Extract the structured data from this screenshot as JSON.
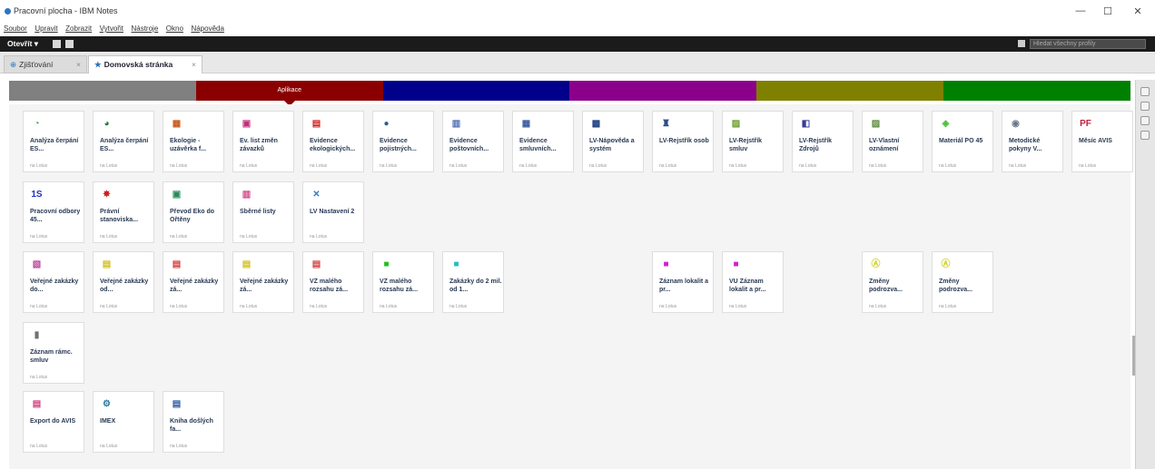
{
  "window": {
    "title": "Pracovní plocha - IBM Notes",
    "minimize": "—",
    "maximize": "☐",
    "close": "✕"
  },
  "menu": [
    "Soubor",
    "Upravit",
    "Zobrazit",
    "Vytvořit",
    "Nástroje",
    "Okno",
    "Nápověda"
  ],
  "toolbar": {
    "open_label": "Otevřít ▾",
    "search_placeholder": "Hledat všechny profily"
  },
  "tabs": [
    {
      "label": "Zjišťování",
      "icon": "⊕",
      "close": "×"
    },
    {
      "label": "Domovská stránka",
      "icon": "★",
      "close": "×"
    }
  ],
  "categories": [
    {
      "label": "",
      "color": "#808080"
    },
    {
      "label": "Aplikace",
      "color": "#8a0000"
    },
    {
      "label": "",
      "color": "#00008b"
    },
    {
      "label": "",
      "color": "#8b008b"
    },
    {
      "label": "",
      "color": "#808000"
    },
    {
      "label": "",
      "color": "#008000"
    }
  ],
  "server_label": "na Lotus",
  "tiles": [
    {
      "name": "Analýza čerpání ES...",
      "glyph": "◔",
      "color": "#2ea84a"
    },
    {
      "name": "Analýza čerpání ES...",
      "glyph": "◕",
      "color": "#1a7a3a"
    },
    {
      "name": "Ekologie - uzávěrka f...",
      "glyph": "▦",
      "color": "#c85a1a"
    },
    {
      "name": "Ev. list změn závazků",
      "glyph": "▣",
      "color": "#c0307a"
    },
    {
      "name": "Evidence ekologických...",
      "glyph": "▤",
      "color": "#d02020"
    },
    {
      "name": "Evidence pojistných...",
      "glyph": "●",
      "color": "#345e8a"
    },
    {
      "name": "Evidence poštovních...",
      "glyph": "▥",
      "color": "#4a6ab0"
    },
    {
      "name": "Evidence smluvních...",
      "glyph": "▦",
      "color": "#3a5aa0"
    },
    {
      "name": "LV-Nápověda a systém",
      "glyph": "▩",
      "color": "#204080"
    },
    {
      "name": "LV-Rejstřík osob",
      "glyph": "♜",
      "color": "#2a4a8a"
    },
    {
      "name": "LV-Rejstřík smluv",
      "glyph": "▨",
      "color": "#6a9a2a"
    },
    {
      "name": "LV-Rejstřík Zdrojů",
      "glyph": "◧",
      "color": "#3a3a9a"
    },
    {
      "name": "LV-Vlastní oznámení",
      "glyph": "▨",
      "color": "#5a8a3a"
    },
    {
      "name": "Materiál PO 45",
      "glyph": "◈",
      "color": "#4ac040"
    },
    {
      "name": "Metodické pokyny V...",
      "glyph": "◉",
      "color": "#6a7a8a"
    },
    {
      "name": "Měsíc AVIS",
      "glyph": "PF",
      "color": "#c02040"
    },
    {
      "name": "Pracovní odbory 45...",
      "glyph": "1S",
      "color": "#2030c0"
    },
    {
      "name": "Právní stanoviska...",
      "glyph": "✸",
      "color": "#d02020"
    },
    {
      "name": "Převod Eko do Ořtěny",
      "glyph": "▣",
      "color": "#2a8a5a"
    },
    {
      "name": "Sběrné listy",
      "glyph": "▥",
      "color": "#d04080"
    },
    {
      "name": "LV Nastavení 2",
      "glyph": "✕",
      "color": "#3a7ac0"
    },
    {
      "name": "Veřejné zakázky do...",
      "glyph": "▧",
      "color": "#c040a0"
    },
    {
      "name": "Veřejné zakázky od...",
      "glyph": "▤",
      "color": "#d0c020"
    },
    {
      "name": "Veřejné zakázky zá...",
      "glyph": "▤",
      "color": "#d04040"
    },
    {
      "name": "Veřejné zakázky zá...",
      "glyph": "▤",
      "color": "#d0c020"
    },
    {
      "name": "VZ malého rozsahu zá...",
      "glyph": "▤",
      "color": "#d04040"
    },
    {
      "name": "VZ malého rozsahu zá...",
      "glyph": "■",
      "color": "#20c020"
    },
    {
      "name": "Zakázky do 2 mil. od 1...",
      "glyph": "■",
      "color": "#20c0c0"
    },
    {
      "name": "Záznam lokalit a pr...",
      "glyph": "■",
      "color": "#d020d0"
    },
    {
      "name": "VU Záznam lokalit a pr...",
      "glyph": "■",
      "color": "#d020d0"
    },
    {
      "name": "Změny podrozva...",
      "glyph": "Ⓐ",
      "color": "#d0d020"
    },
    {
      "name": "Změny podrozva...",
      "glyph": "Ⓐ",
      "color": "#d0d020"
    },
    {
      "name": "Záznam rámc. smluv",
      "glyph": "▮",
      "color": "#707070"
    },
    {
      "name": "Export do AVIS",
      "glyph": "▤",
      "color": "#d04080"
    },
    {
      "name": "IMEX",
      "glyph": "⚙",
      "color": "#2a7aa0"
    },
    {
      "name": "Kniha došlých fa...",
      "glyph": "▤",
      "color": "#2a5aa0"
    }
  ]
}
